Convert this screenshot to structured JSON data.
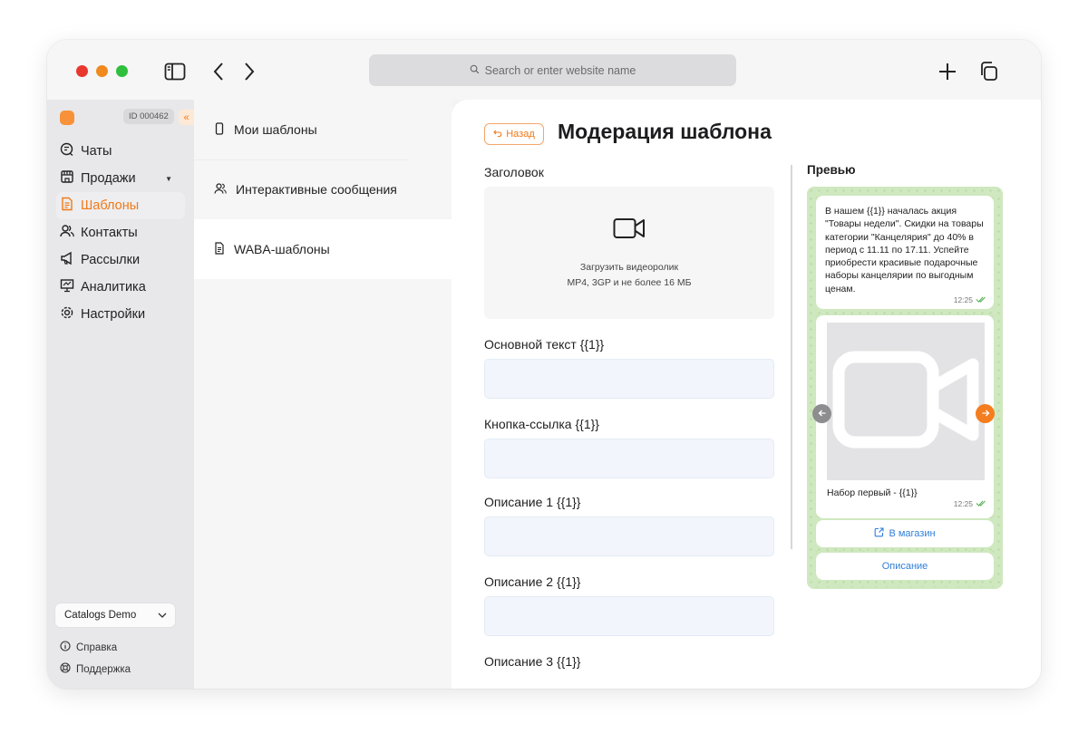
{
  "browser": {
    "url_placeholder": "Search or enter website name"
  },
  "sidebar": {
    "account_id": "ID 000462",
    "collapse_glyph": "«",
    "items": [
      {
        "label": "Чаты",
        "icon": "chat-icon"
      },
      {
        "label": "Продажи",
        "icon": "store-icon",
        "has_caret": true
      },
      {
        "label": "Шаблоны",
        "icon": "template-icon",
        "active": true
      },
      {
        "label": "Контакты",
        "icon": "contacts-icon"
      },
      {
        "label": "Рассылки",
        "icon": "megaphone-icon"
      },
      {
        "label": "Аналитика",
        "icon": "analytics-icon"
      },
      {
        "label": "Настройки",
        "icon": "gear-icon"
      }
    ],
    "workspace": "Catalogs Demo",
    "help": "Справка",
    "support": "Поддержка"
  },
  "templates_menu": {
    "items": [
      {
        "label": "Мои шаблоны",
        "icon": "phone-icon"
      },
      {
        "label": "Интерактивные сообщения",
        "icon": "users-icon"
      },
      {
        "label": "WABA-шаблоны",
        "icon": "document-icon",
        "active": true
      }
    ]
  },
  "main": {
    "back_label": "Назад",
    "title": "Модерация шаблона",
    "header_label": "Заголовок",
    "upload_title": "Загрузить видеоролик",
    "upload_hint": "MP4, 3GP и не более 16 МБ",
    "body_label": "Основной текст {{1}}",
    "link_button_label": "Кнопка-ссылка {{1}}",
    "desc1_label": "Описание  1 {{1}}",
    "desc2_label": "Описание  2 {{1}}",
    "desc3_label": "Описание 3 {{1}}"
  },
  "preview": {
    "label": "Превью",
    "message": "В нашем {{1}} началась акция \"Товары недели\". Скидки на товары категории \"Канцелярия\" до 40% в период с 11.11 по 17.11. Успейте приобрести красивые подарочные наборы канцелярии по выгодным ценам.",
    "message_time": "12:25",
    "card_caption": "Набор первый - {{1}}",
    "card_time": "12:25",
    "shop_button": "В магазин",
    "desc_button": "Описание"
  },
  "colors": {
    "accent": "#f07a1a",
    "link": "#2f7fd9",
    "chat_bg": "#cfe8bf"
  }
}
